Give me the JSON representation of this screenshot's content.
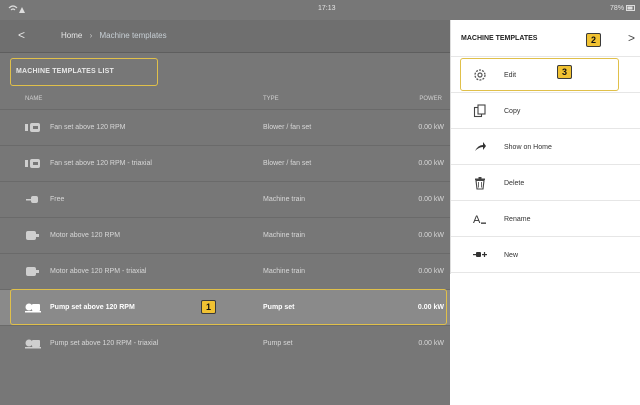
{
  "status": {
    "time": "17:13",
    "battery": "78%"
  },
  "nav": {
    "back": "<",
    "home": "Home",
    "separator": "›",
    "current": "Machine templates"
  },
  "list": {
    "title": "MACHINE TEMPLATES LIST",
    "columns": {
      "name": "NAME",
      "type": "TYPE",
      "power": "POWER"
    },
    "rows": [
      {
        "name": "Fan set above 120 RPM",
        "type": "Blower / fan set",
        "power": "0.00 kW",
        "icon": "fan-set-icon"
      },
      {
        "name": "Fan set above 120 RPM - triaxial",
        "type": "Blower / fan set",
        "power": "0.00 kW",
        "icon": "fan-set-icon"
      },
      {
        "name": "Free",
        "type": "Machine train",
        "power": "0.00 kW",
        "icon": "free-machine-icon"
      },
      {
        "name": "Motor above 120 RPM",
        "type": "Machine train",
        "power": "0.00 kW",
        "icon": "motor-icon"
      },
      {
        "name": "Motor above 120 RPM - triaxial",
        "type": "Machine train",
        "power": "0.00 kW",
        "icon": "motor-icon"
      },
      {
        "name": "Pump set above 120 RPM",
        "type": "Pump set",
        "power": "0.00 kW",
        "icon": "pump-set-icon",
        "selected": true
      },
      {
        "name": "Pump set above 120 RPM - triaxial",
        "type": "Pump set",
        "power": "0.00 kW",
        "icon": "pump-set-icon"
      }
    ]
  },
  "panel": {
    "title": "MACHINE TEMPLATES",
    "close": ">",
    "items": [
      {
        "label": "Edit",
        "icon": "gear-icon"
      },
      {
        "label": "Copy",
        "icon": "copy-icon"
      },
      {
        "label": "Show on Home",
        "icon": "arrow-icon"
      },
      {
        "label": "Delete",
        "icon": "trash-icon"
      },
      {
        "label": "Rename",
        "icon": "rename-icon"
      },
      {
        "label": "New",
        "icon": "new-machine-icon"
      }
    ]
  },
  "badges": {
    "one": "1",
    "two": "2",
    "three": "3"
  },
  "colors": {
    "highlight": "#e0c04a",
    "badge": "#f1c232",
    "dim": "#777777"
  }
}
